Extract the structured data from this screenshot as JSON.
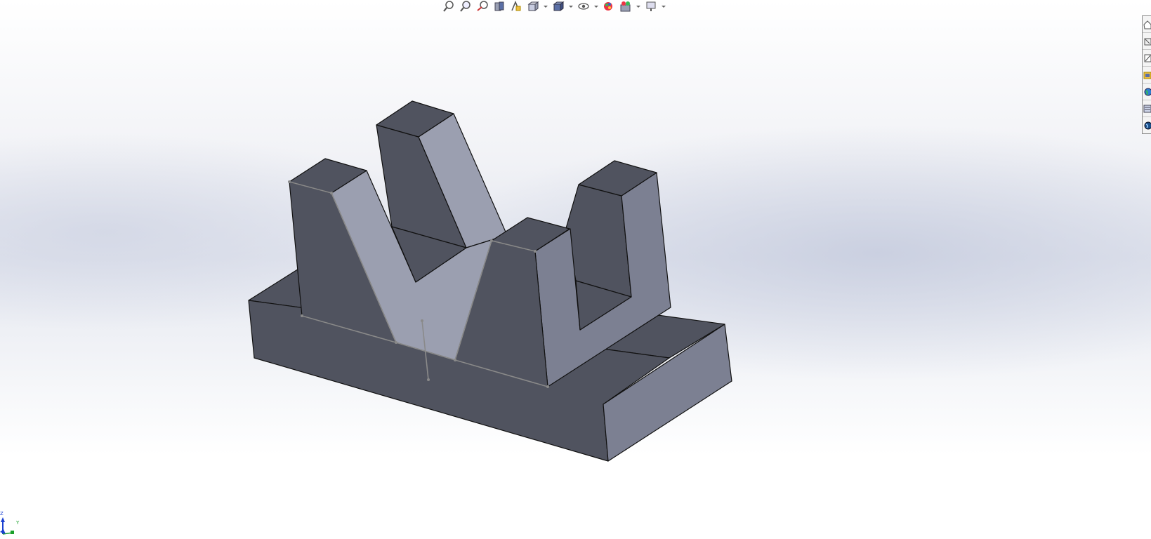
{
  "viewport": {
    "name": "graphics-area"
  },
  "heads_up_toolbar": {
    "tools": [
      {
        "icon": "zoom-to-fit-icon",
        "dropdown": false
      },
      {
        "icon": "zoom-to-area-icon",
        "dropdown": false
      },
      {
        "icon": "previous-view-icon",
        "dropdown": false
      },
      {
        "icon": "section-view-icon",
        "dropdown": false
      },
      {
        "icon": "dynamic-annotation-views-icon",
        "dropdown": false
      },
      {
        "icon": "view-orientation-icon",
        "dropdown": true
      },
      {
        "icon": "display-style-icon",
        "dropdown": true
      },
      {
        "icon": "hide-show-items-icon",
        "dropdown": true
      },
      {
        "icon": "edit-appearance-icon",
        "dropdown": false
      },
      {
        "icon": "apply-scene-icon",
        "dropdown": true
      },
      {
        "icon": "view-settings-icon",
        "dropdown": true
      }
    ]
  },
  "task_pane": {
    "tabs": [
      {
        "icon": "home-icon"
      },
      {
        "icon": "3d-parts-icon"
      },
      {
        "icon": "design-library-icon"
      },
      {
        "icon": "file-explorer-icon"
      },
      {
        "icon": "view-palette-icon"
      },
      {
        "icon": "appearances-icon"
      },
      {
        "icon": "custom-properties-icon"
      }
    ]
  },
  "triad": {
    "axis_z": "Z",
    "axis_y": "Y"
  },
  "colors": {
    "face_dark": "#50535f",
    "face_light": "#9b9fb0",
    "face_mid": "#7c8092",
    "edge": "#111111",
    "sketch": "#8a8a8a"
  }
}
